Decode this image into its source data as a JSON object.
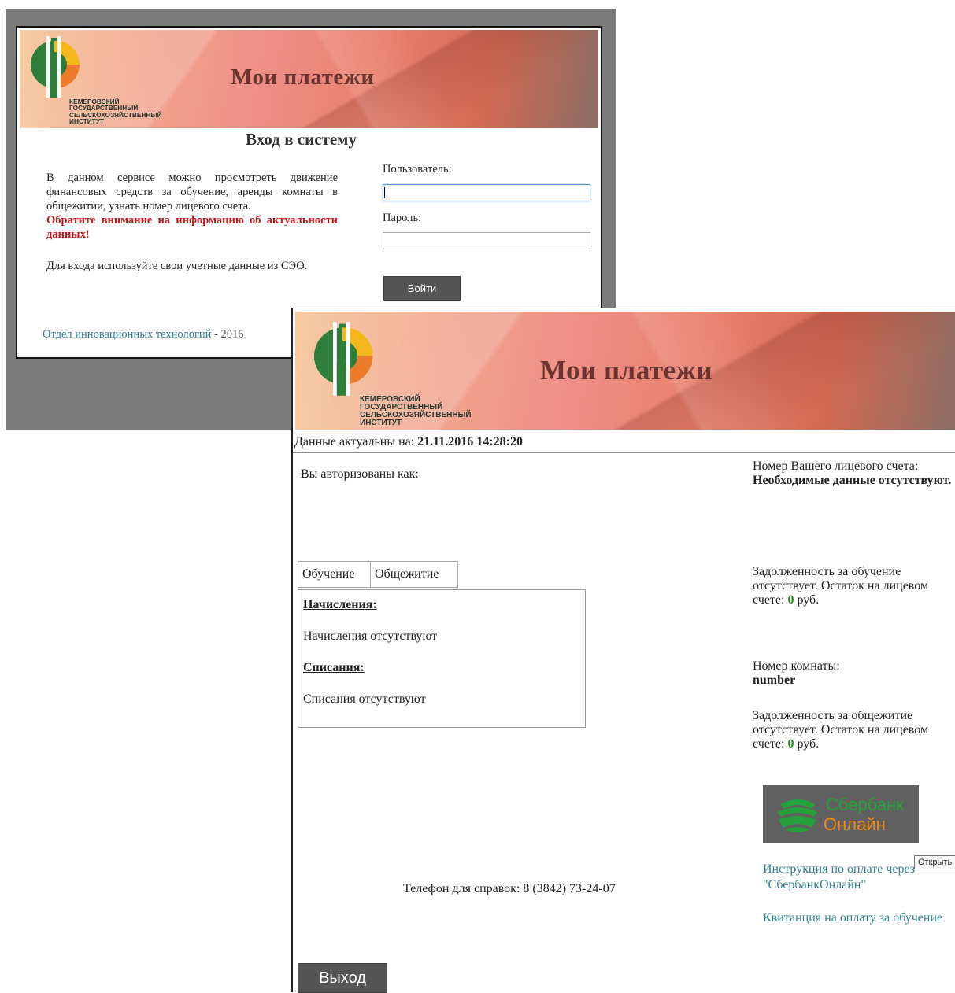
{
  "login_window": {
    "banner": {
      "title": "Мои платежи",
      "logo_text": [
        "КЕМЕРОВСКИЙ",
        "ГОСУДАРСТВЕННЫЙ",
        "СЕЛЬСКОХОЗЯЙСТВЕННЫЙ",
        "ИНСТИТУТ"
      ]
    },
    "heading": "Вход в систему",
    "description": "В данном сервисе можно просмотреть движение финансовых средств за обучение, аренды комнаты в общежитии, узнать номер лицевого счета.",
    "warning": "Обратите внимание на информацию об актуальности данных!",
    "note": "Для входа используйте свои учетные данные из СЭО.",
    "form": {
      "user_label": "Пользователь:",
      "user_value": "",
      "password_label": "Пароль:",
      "password_value": "",
      "submit_label": "Войти"
    },
    "footer": {
      "link_text": "Отдел инновационных технологий",
      "suffix": " - 2016"
    }
  },
  "payments_window": {
    "banner": {
      "title": "Мои платежи",
      "logo_text": [
        "КЕМЕРОВСКИЙ",
        "ГОСУДАРСТВЕННЫЙ",
        "СЕЛЬСКОХОЗЯЙСТВЕННЫЙ",
        "ИНСТИТУТ"
      ]
    },
    "actual": {
      "label": "Данные актуальны на: ",
      "datetime": "21.11.2016 14:28:20"
    },
    "auth_label": "Вы авторизованы как:",
    "account": {
      "label": "Номер Вашего лицевого счета: ",
      "value": "Необходимые данные отсутствуют."
    },
    "tabs": [
      {
        "label": "Обучение",
        "active": true
      },
      {
        "label": "Общежитие",
        "active": false
      }
    ],
    "panel": {
      "charges_title": "Начисления:",
      "charges_text": "Начисления отсутствуют",
      "writeoffs_title": "Списания:",
      "writeoffs_text": "Списания отсутствуют"
    },
    "education_debt": {
      "text": "Задолженность за обучение отсутствует. Остаток на лицевом счете: ",
      "amount": "0",
      "currency": " руб."
    },
    "room": {
      "label": "Номер комнаты:",
      "value": "number"
    },
    "dorm_debt": {
      "text": "Задолженность за общежитие отсутствует. Остаток на лицевом счете: ",
      "amount": "0",
      "currency": " руб."
    },
    "sberbank": {
      "line1": "Сбербанк",
      "line2": "Онлайн"
    },
    "instruction_link": "Инструкция по оплате через \"СбербанкОнлайн\"",
    "tooltip": "Открыть",
    "receipt_link": "Квитанция на оплату за обучение",
    "phone": "Телефон для справок: 8 (3842) 73-24-07",
    "exit_label": "Выход"
  },
  "colors": {
    "warning": "#c01818",
    "link": "#2f7f8f",
    "amount": "#1e8a1e",
    "sber_green": "#23a23a",
    "sber_orange": "#f28a16",
    "button": "#555555"
  }
}
